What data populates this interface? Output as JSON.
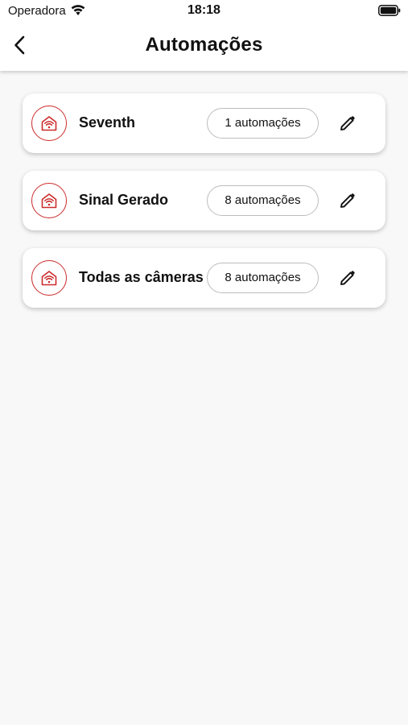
{
  "status_bar": {
    "carrier": "Operadora",
    "time": "18:18"
  },
  "header": {
    "title": "Automações"
  },
  "accent_color": "#cc2b2b",
  "groups": [
    {
      "name": "Seventh",
      "badge": "1 automações",
      "icon": "smart-home-wifi-icon"
    },
    {
      "name": "Sinal Gerado",
      "badge": "8 automações",
      "icon": "smart-home-wifi-icon"
    },
    {
      "name": "Todas as câmeras",
      "badge": "8 automações",
      "icon": "smart-home-wifi-icon"
    }
  ]
}
